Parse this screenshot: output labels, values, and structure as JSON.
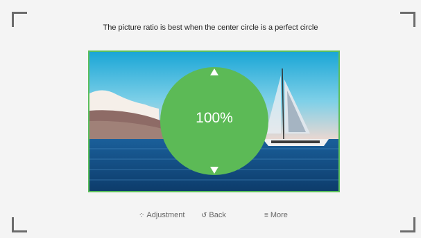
{
  "instruction": "The picture ratio is best when the center circle is a perfect circle",
  "ratio": {
    "value": "100%"
  },
  "hints": [
    {
      "icon": "dpad-icon",
      "glyph": "⁘",
      "label": "Adjustment"
    },
    {
      "icon": "back-icon",
      "glyph": "↺",
      "label": "Back"
    },
    {
      "icon": "menu-icon",
      "glyph": "≡",
      "label": "More"
    }
  ],
  "colors": {
    "accent": "#5cbf5c",
    "circle": "#5cba56",
    "background": "#f4f4f4"
  }
}
